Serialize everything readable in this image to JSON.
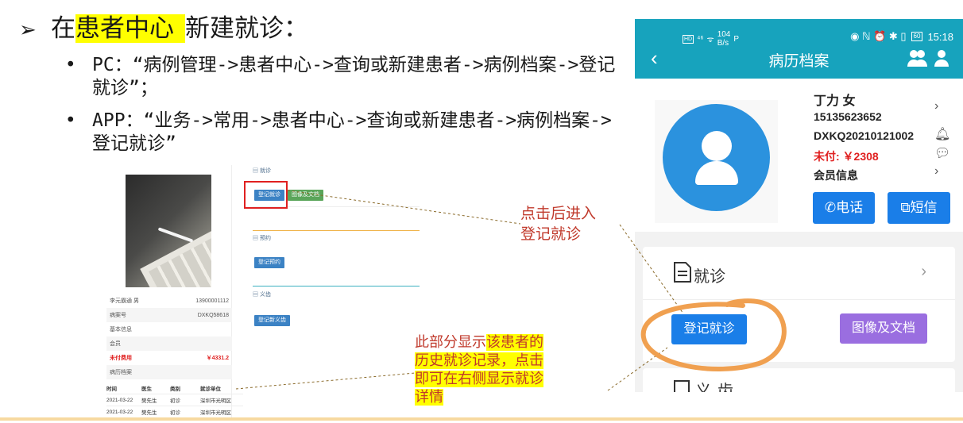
{
  "slide": {
    "arrow": "➢",
    "heading_prefix": "在",
    "heading_highlight": "患者中心",
    "heading_suffix": "新建就诊：",
    "bullets": [
      {
        "dot": "•",
        "text": "PC：“病例管理->患者中心->查询或新建患者->病例档案->登记就诊”；"
      },
      {
        "dot": "•",
        "text": "APP：“业务->常用->患者中心->查询或新建患者->病例档案->登记就诊”"
      }
    ]
  },
  "pc": {
    "sections": {
      "visit": "就诊",
      "appointment": "预约",
      "dentures": "义齿"
    },
    "buttons": {
      "register_visit": "登记就诊",
      "images_docs": "图像及文档",
      "register_appointment": "登记预约",
      "new_denture": "登记新义齿"
    },
    "patient": {
      "name_gender": "李元霸通 男",
      "phone": "13900001112",
      "record_label": "病案号",
      "record_no": "DXKQ58618",
      "basic_info": "基本信息",
      "member": "会员",
      "unpaid_label": "未付费用",
      "unpaid_value": "￥4331.2",
      "history_label": "病历档案"
    },
    "table": {
      "headers": [
        "时间",
        "医生",
        "类别",
        "就诊单位"
      ],
      "rows": [
        [
          "2021-03-22",
          "樊先生",
          "初诊",
          "深圳市光明区"
        ],
        [
          "2021-03-22",
          "樊先生",
          "初诊",
          "深圳市光明区"
        ]
      ]
    }
  },
  "callouts": {
    "first": [
      "点击后进入",
      "登记就诊"
    ],
    "second_prefix": "此部分显示",
    "second_highlight_1": "该患者的",
    "second_line_2": "历史就诊记录，点击",
    "second_line_3": "即可在右侧显示就诊",
    "second_line_4": "详情"
  },
  "phone": {
    "status": {
      "hd": "HD",
      "signal": "⁴⁶",
      "wifi": "ᯤ",
      "net_top": "104",
      "net_bottom": "B/s",
      "p": "P",
      "right_icons": "◉ ℕ ⏰ ✱ ▯",
      "battery": "60",
      "time": "15:18"
    },
    "back": "‹",
    "title": "病历档案",
    "patient": {
      "name_gender": "丁力 女",
      "phone": "15135623652",
      "record_no": "DXKQ20210121002",
      "unpaid": "未付: ￥2308",
      "member_info": "会员信息"
    },
    "buttons": {
      "call": "电话",
      "sms": "短信",
      "register_visit": "登记就诊",
      "images_docs": "图像及文档"
    },
    "icons": {
      "call": "✆",
      "sms": "⧉",
      "chevron": "›",
      "bell": "🔔︎",
      "chat": "💬︎"
    },
    "visit_section": "就诊",
    "next_section": "义齿"
  },
  "colors": {
    "highlight": "#ffff00",
    "phone_header": "#17a3bd",
    "primary_button": "#1a7ee8",
    "purple_button": "#9a6ee0",
    "annotation_red": "#c0392b",
    "circle_orange": "#f0a050"
  }
}
